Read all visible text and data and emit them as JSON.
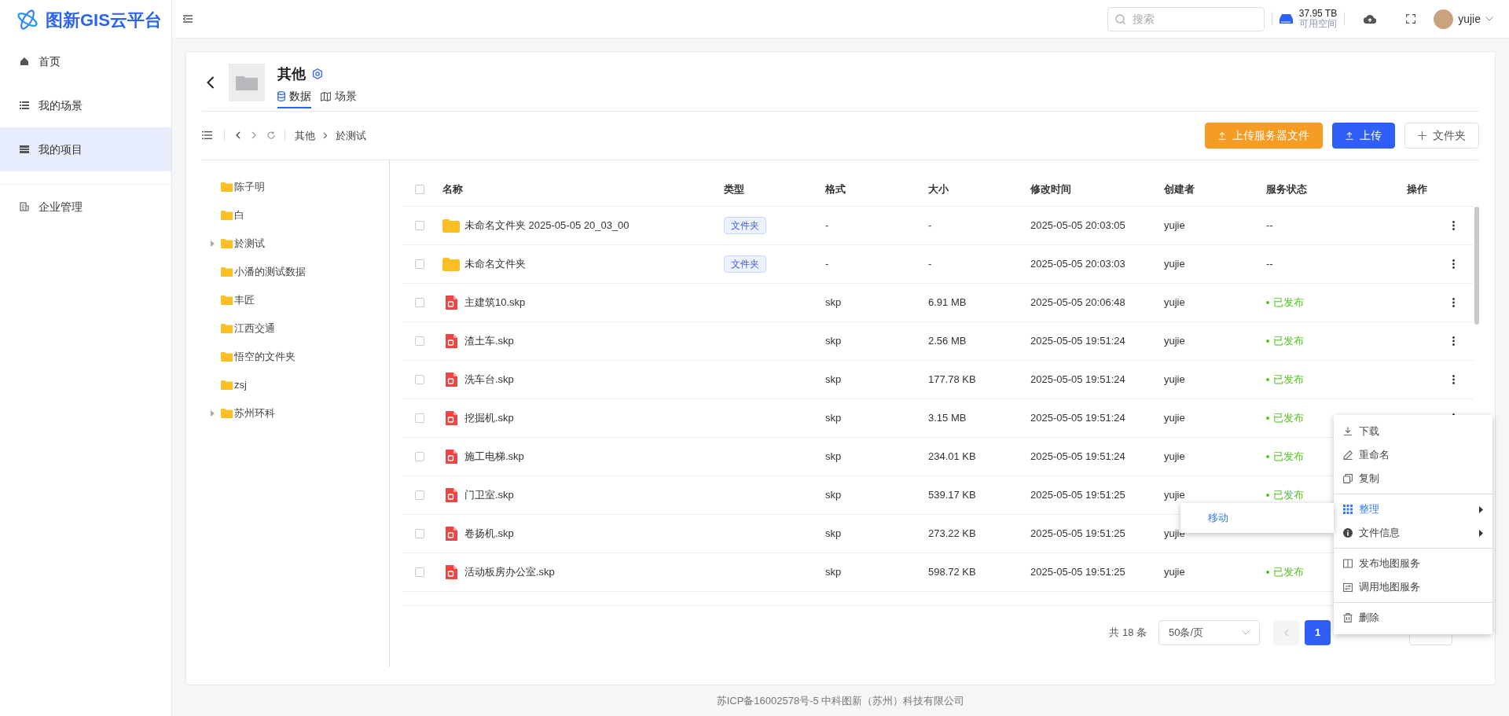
{
  "sidebar": {
    "logo": "图新GIS云平台",
    "sections": [
      [
        {
          "label": "首页",
          "selected": false
        },
        {
          "label": "我的场景",
          "selected": false
        },
        {
          "label": "我的项目",
          "selected": true
        }
      ],
      [
        {
          "label": "企业管理",
          "selected": false
        }
      ]
    ]
  },
  "header": {
    "search": {
      "placeholder": "搜索"
    },
    "storage": {
      "value": "37.95 TB",
      "label": "可用空间"
    },
    "user": "yujie"
  },
  "project": {
    "title": "其他",
    "tabs": [
      {
        "label": "数据",
        "selected": true
      },
      {
        "label": "场景",
        "selected": false
      }
    ]
  },
  "breadcrumb": [
    "其他",
    "於测试"
  ],
  "actions": [
    {
      "label": "上传服务器文件",
      "kind": "orange"
    },
    {
      "label": "上传",
      "kind": "primary"
    },
    {
      "label": "文件夹",
      "kind": "plain"
    }
  ],
  "tree": [
    {
      "label": "陈子明",
      "kind": "leaf"
    },
    {
      "label": "白",
      "kind": "leaf"
    },
    {
      "label": "於测试",
      "kind": "branch"
    },
    {
      "label": "小潘的测试数据",
      "kind": "leaf"
    },
    {
      "label": "丰匠",
      "kind": "leaf"
    },
    {
      "label": "江西交通",
      "kind": "leaf"
    },
    {
      "label": "悟空的文件夹",
      "kind": "leaf"
    },
    {
      "label": "zsj",
      "kind": "leaf"
    },
    {
      "label": "苏州环科",
      "kind": "branch"
    }
  ],
  "table": {
    "select_all": {
      "checked": false
    },
    "columns": [
      "名称",
      "类型",
      "格式",
      "大小",
      "修改时间",
      "创建者",
      "服务状态",
      "操作"
    ],
    "rows": [
      {
        "checked": false,
        "kind": "folder",
        "name": "未命名文件夹 2025-05-05 20_03_00",
        "type": "文件夹",
        "format": "-",
        "size": "-",
        "modified": "2025-05-05 20:03:05",
        "creator": "yujie",
        "status": "--",
        "published": false
      },
      {
        "checked": false,
        "kind": "folder",
        "name": "未命名文件夹",
        "type": "文件夹",
        "format": "-",
        "size": "-",
        "modified": "2025-05-05 20:03:03",
        "creator": "yujie",
        "status": "--",
        "published": false
      },
      {
        "checked": false,
        "kind": "file",
        "name": "主建筑10.skp",
        "format": "skp",
        "size": "6.91 MB",
        "modified": "2025-05-05 20:06:48",
        "creator": "yujie",
        "status": "已发布",
        "published": true
      },
      {
        "checked": false,
        "kind": "file",
        "name": "渣土车.skp",
        "format": "skp",
        "size": "2.56 MB",
        "modified": "2025-05-05 19:51:24",
        "creator": "yujie",
        "status": "已发布",
        "published": true
      },
      {
        "checked": false,
        "kind": "file",
        "name": "洗车台.skp",
        "format": "skp",
        "size": "177.78 KB",
        "modified": "2025-05-05 19:51:24",
        "creator": "yujie",
        "status": "已发布",
        "published": true
      },
      {
        "checked": false,
        "kind": "file",
        "name": "挖掘机.skp",
        "format": "skp",
        "size": "3.15 MB",
        "modified": "2025-05-05 19:51:24",
        "creator": "yujie",
        "status": "已发布",
        "published": true
      },
      {
        "checked": false,
        "kind": "file",
        "name": "施工电梯.skp",
        "format": "skp",
        "size": "234.01 KB",
        "modified": "2025-05-05 19:51:24",
        "creator": "yujie",
        "status": "已发布",
        "published": true
      },
      {
        "checked": false,
        "kind": "file",
        "name": "门卫室.skp",
        "format": "skp",
        "size": "539.17 KB",
        "modified": "2025-05-05 19:51:25",
        "creator": "yujie",
        "status": "已发布",
        "published": true
      },
      {
        "checked": false,
        "kind": "file",
        "name": "卷扬机.skp",
        "format": "skp",
        "size": "273.22 KB",
        "modified": "2025-05-05 19:51:25",
        "creator": "yujie"
      },
      {
        "checked": false,
        "kind": "file",
        "name": "活动板房办公室.skp",
        "format": "skp",
        "size": "598.72 KB",
        "modified": "2025-05-05 19:51:25",
        "creator": "yujie",
        "status": "已发布",
        "published": true
      }
    ]
  },
  "pagination": {
    "total": "共 18 条",
    "page_size": "50条/页",
    "pages": [
      {
        "label": "1",
        "selected": true
      }
    ]
  },
  "context_menu": {
    "groups": [
      [
        {
          "label": "下载",
          "selected": false,
          "submenu": false
        },
        {
          "label": "重命名",
          "selected": false,
          "submenu": false
        },
        {
          "label": "复制",
          "selected": false,
          "submenu": false
        }
      ],
      [
        {
          "label": "整理",
          "selected": true,
          "submenu": true
        },
        {
          "label": "文件信息",
          "selected": false,
          "submenu": true
        }
      ],
      [
        {
          "label": "发布地图服务",
          "selected": false,
          "submenu": false
        },
        {
          "label": "调用地图服务",
          "selected": false,
          "submenu": false
        }
      ],
      [
        {
          "label": "删除",
          "selected": false,
          "submenu": false
        }
      ]
    ],
    "submenu": [
      {
        "label": "移动"
      }
    ]
  },
  "footer": "苏ICP备16002578号-5 中科图新（苏州）科技有限公司"
}
